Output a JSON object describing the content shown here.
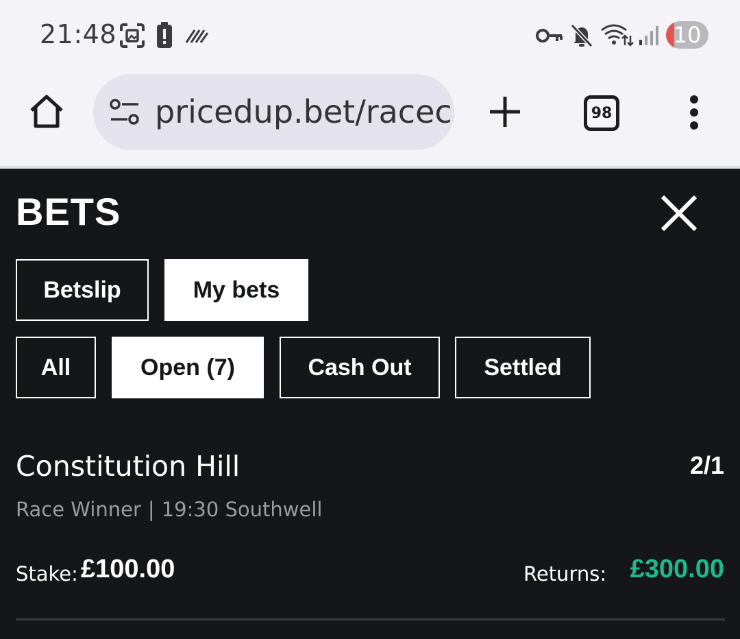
{
  "status_bar": {
    "time": "21:48",
    "battery_level": "10",
    "icons": [
      "screenshot-icon",
      "battery-alert-icon",
      "nfc-icon",
      "vpn-key-icon",
      "mute-icon",
      "wifi-icon",
      "signal-icon"
    ]
  },
  "browser": {
    "url": "pricedup.bet/raceca",
    "tab_count": "98",
    "icons": [
      "home-icon",
      "site-settings-icon",
      "new-tab-icon",
      "tabs-icon",
      "more-menu-icon"
    ]
  },
  "bets_panel": {
    "title": "BETS",
    "primary_tabs": [
      {
        "label": "Betslip",
        "active": false
      },
      {
        "label": "My bets",
        "active": true
      }
    ],
    "filter_tabs": [
      {
        "label": "All",
        "active": false
      },
      {
        "label": "Open (7)",
        "active": true
      },
      {
        "label": "Cash Out",
        "active": false
      },
      {
        "label": "Settled",
        "active": false
      }
    ],
    "bets": [
      {
        "selection": "Constitution Hill",
        "odds": "2/1",
        "market": "Race Winner",
        "separator": "|",
        "event": "19:30 Southwell",
        "stake_label": "Stake:",
        "stake": "£100.00",
        "returns_label": "Returns:",
        "returns": "£300.00"
      }
    ]
  },
  "colors": {
    "panel_background": "#15161a",
    "returns_green": "#1fb98c",
    "browser_chrome": "#f4f3f8"
  }
}
